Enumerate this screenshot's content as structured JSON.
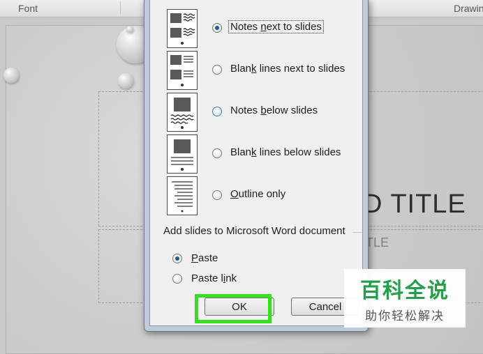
{
  "ribbon": {
    "font_group": "Font",
    "drawing_group": "Drawin"
  },
  "slide": {
    "title_text": "D TITLE",
    "subtitle_text": "TITLE"
  },
  "dialog": {
    "layout_options": [
      {
        "label_pre": "Notes ",
        "mnemonic": "n",
        "label_post": "ext to slides",
        "checked": true,
        "icon": "notes-next-to-slides-icon"
      },
      {
        "label_pre": "Blan",
        "mnemonic": "k",
        "label_post": " lines next to slides",
        "checked": false,
        "icon": "blank-lines-next-to-slides-icon"
      },
      {
        "label_pre": "Notes ",
        "mnemonic": "b",
        "label_post": "elow slides",
        "checked": false,
        "icon": "notes-below-slides-icon"
      },
      {
        "label_pre": "Blan",
        "mnemonic": "k",
        "label_post": " lines below slides",
        "checked": false,
        "icon": "blank-lines-below-slides-icon"
      },
      {
        "label_pre": "",
        "mnemonic": "O",
        "label_post": "utline only",
        "checked": false,
        "icon": "outline-only-icon"
      }
    ],
    "add_slides_label": "Add slides to Microsoft Word document",
    "paste_options": [
      {
        "label_pre": "",
        "mnemonic": "P",
        "label_post": "aste",
        "checked": true
      },
      {
        "label_pre": "Paste l",
        "mnemonic": "i",
        "label_post": "nk",
        "checked": false
      }
    ],
    "ok_label": "OK",
    "cancel_label": "Cancel"
  },
  "watermark": {
    "line1": "百科全说",
    "line2": "助你轻松解决"
  },
  "colors": {
    "highlight": "#36e01e",
    "watermark_green": "#23a04a",
    "dialog_frame": "#bfcbda"
  }
}
